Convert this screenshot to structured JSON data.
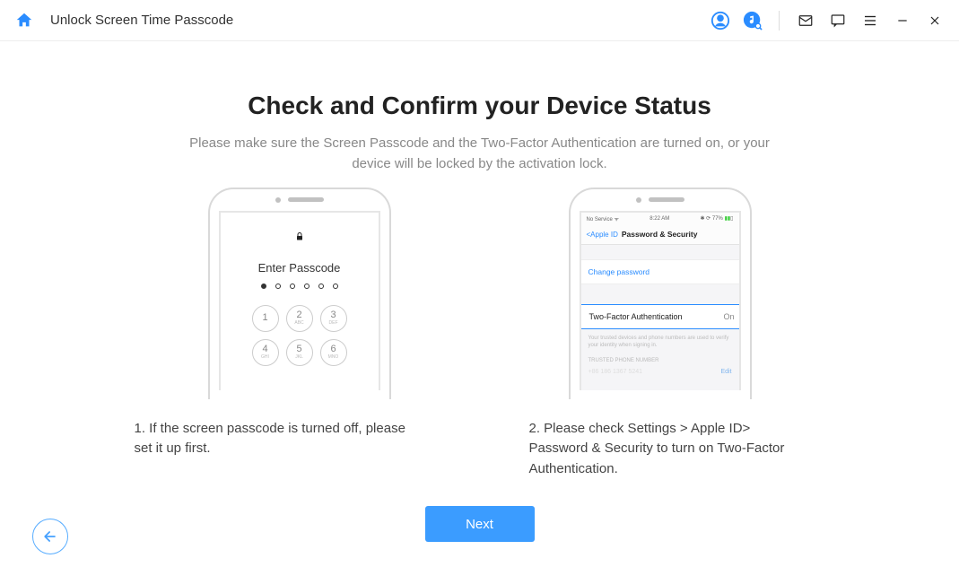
{
  "titlebar": {
    "title": "Unlock Screen Time Passcode"
  },
  "main": {
    "heading": "Check and Confirm your Device Status",
    "subtitle_line1": "Please make sure the Screen Passcode and the Two-Factor Authentication are turned on, or your",
    "subtitle_line2": "device will be locked by the activation lock."
  },
  "phone1": {
    "enter_passcode": "Enter Passcode",
    "keys": {
      "k1": "1",
      "k2": "2",
      "k2l": "ABC",
      "k3": "3",
      "k3l": "DEF",
      "k4": "4",
      "k4l": "GHI",
      "k5": "5",
      "k5l": "JKL",
      "k6": "6",
      "k6l": "MNO"
    }
  },
  "phone2": {
    "status_left": "No Service",
    "status_time": "8:22 AM",
    "status_right": "77%",
    "back": "Apple ID",
    "navtitle": "Password & Security",
    "change_password": "Change password",
    "tfa_label": "Two-Factor Authentication",
    "tfa_state": "On",
    "note": "Your trusted devices and phone numbers are used to verify your identity when signing in.",
    "trusted_header": "TRUSTED PHONE NUMBER",
    "trusted_number": "+86 186 1367 5241",
    "edit": "Edit"
  },
  "captions": {
    "c1": "1. If the screen passcode is turned off, please set it up first.",
    "c2": "2. Please check Settings > Apple ID> Password & Security to turn on Two-Factor Authentication."
  },
  "buttons": {
    "next": "Next"
  }
}
